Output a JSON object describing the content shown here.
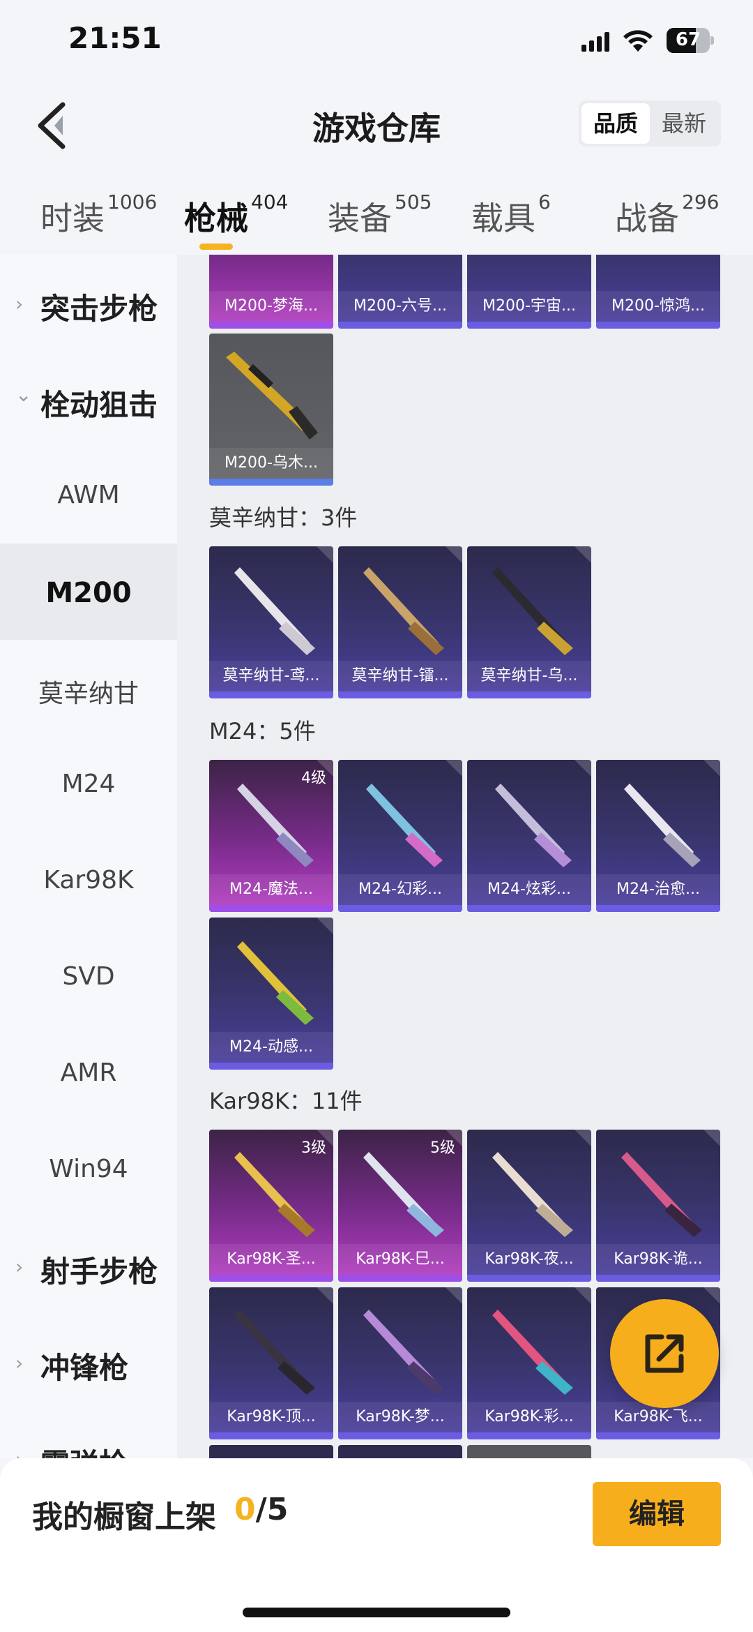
{
  "status_bar": {
    "time": "21:51",
    "battery": "67",
    "battery_level": 0.67
  },
  "header": {
    "title": "游戏仓库",
    "sort_options": [
      "品质",
      "最新"
    ]
  },
  "tabs": [
    {
      "label": "时装",
      "count": "1006"
    },
    {
      "label": "枪械",
      "count": "404"
    },
    {
      "label": "装备",
      "count": "505"
    },
    {
      "label": "载具",
      "count": "6"
    },
    {
      "label": "战备",
      "count": "296"
    }
  ],
  "sidebar": {
    "categories": [
      {
        "label": "突击步枪"
      },
      {
        "label": "栓动狙击"
      },
      {
        "label": "射手步枪"
      },
      {
        "label": "冲锋枪"
      },
      {
        "label": "霰弹枪"
      }
    ],
    "subcategories": [
      "AWM",
      "M200",
      "莫辛纳甘",
      "M24",
      "Kar98K",
      "SVD",
      "AMR",
      "Win94"
    ]
  },
  "content": {
    "m200_row": [
      "M200-梦海...",
      "M200-六号...",
      "M200-宇宙...",
      "M200-惊鸿..."
    ],
    "m200_extra": "M200-乌木...",
    "mosin": {
      "title": "莫辛纳甘：3件",
      "items": [
        "莫辛纳甘-鸢...",
        "莫辛纳甘-镭...",
        "莫辛纳甘-乌..."
      ]
    },
    "m24": {
      "title": "M24：5件",
      "items": [
        "M24-魔法...",
        "M24-幻彩...",
        "M24-炫彩...",
        "M24-治愈...",
        "M24-动感..."
      ],
      "level_first": "4级"
    },
    "kar": {
      "title": "Kar98K：11件",
      "items": [
        "Kar98K-圣...",
        "Kar98K-巳...",
        "Kar98K-夜...",
        "Kar98K-诡...",
        "Kar98K-顶...",
        "Kar98K-梦...",
        "Kar98K-彩...",
        "Kar98K-飞..."
      ],
      "level_1": "3级",
      "level_2": "5级"
    }
  },
  "bottom": {
    "shelf_label": "我的橱窗上架",
    "shelf_current": "0",
    "shelf_total": "/5",
    "edit_label": "编辑"
  },
  "colors": {
    "accent": "#f5b322",
    "rare_purple": "#4b3fa0",
    "epic_pink": "#b63fc4"
  }
}
